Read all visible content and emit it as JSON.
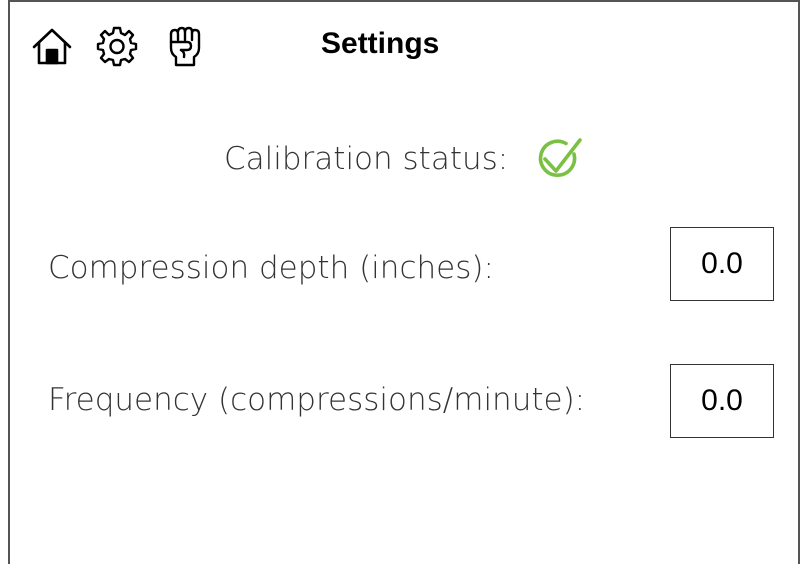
{
  "header": {
    "title": "Settings",
    "icons": [
      "home-icon",
      "gear-icon",
      "fist-icon"
    ]
  },
  "calibration": {
    "label": "Calibration status:",
    "status_icon": "check-circle-icon",
    "status_color": "#7ac143"
  },
  "fields": {
    "depth": {
      "label": "Compression depth (inches):",
      "value": "0.0"
    },
    "frequency": {
      "label": "Frequency (compressions/minute):",
      "value": "0.0"
    }
  }
}
